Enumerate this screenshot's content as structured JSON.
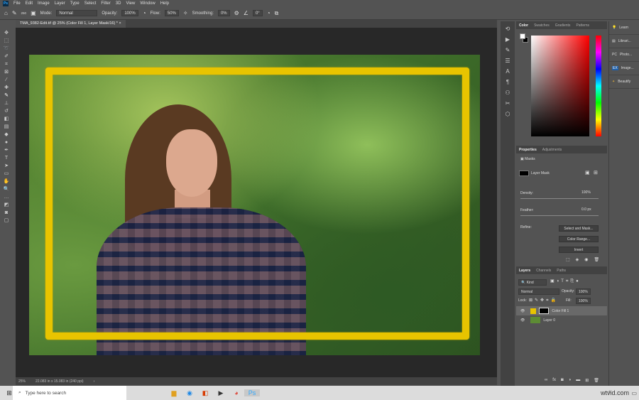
{
  "menu": [
    "File",
    "Edit",
    "Image",
    "Layer",
    "Type",
    "Select",
    "Filter",
    "3D",
    "View",
    "Window",
    "Help"
  ],
  "options": {
    "brush_size": "250",
    "mode_label": "Mode:",
    "mode": "Normal",
    "opacity_label": "Opacity:",
    "opacity": "100%",
    "flow_label": "Flow:",
    "flow": "50%",
    "smoothing_label": "Smoothing:",
    "smoothing": "0%",
    "angle": "0°"
  },
  "document_tab": "TMA_9382-Edit.tif @ 25% (Color Fill 1, Layer Mask/16) *",
  "status": {
    "zoom": "25%",
    "dimensions": "22.083 in x 15.083 in (240 ppi)"
  },
  "color_panel": {
    "tabs": [
      "Color",
      "Swatches",
      "Gradients",
      "Patterns"
    ]
  },
  "properties": {
    "tabs": [
      "Properties",
      "Adjustments"
    ],
    "section": "Masks",
    "mask_label": "Layer Mask",
    "density_label": "Density:",
    "density": "100%",
    "feather_label": "Feather:",
    "feather": "0.0 px",
    "refine_label": "Refine:",
    "buttons": [
      "Select and Mask...",
      "Color Range...",
      "Invert"
    ]
  },
  "layers": {
    "tabs": [
      "Layers",
      "Channels",
      "Paths"
    ],
    "filter": "Kind",
    "blend": "Normal",
    "opacity_label": "Opacity:",
    "opacity": "100%",
    "lock_label": "Lock:",
    "fill_label": "Fill:",
    "fill": "100%",
    "items": [
      "Color Fill 1",
      "Layer 0"
    ]
  },
  "far_panel": [
    "Learn",
    "Librari...",
    "Photo...",
    "Image...",
    "Beautify"
  ],
  "taskbar": {
    "search_placeholder": "Type here to search",
    "watermark": "wtvid.com"
  },
  "colors": {
    "frame": "#e8c400",
    "accent": "#31a8ff"
  }
}
